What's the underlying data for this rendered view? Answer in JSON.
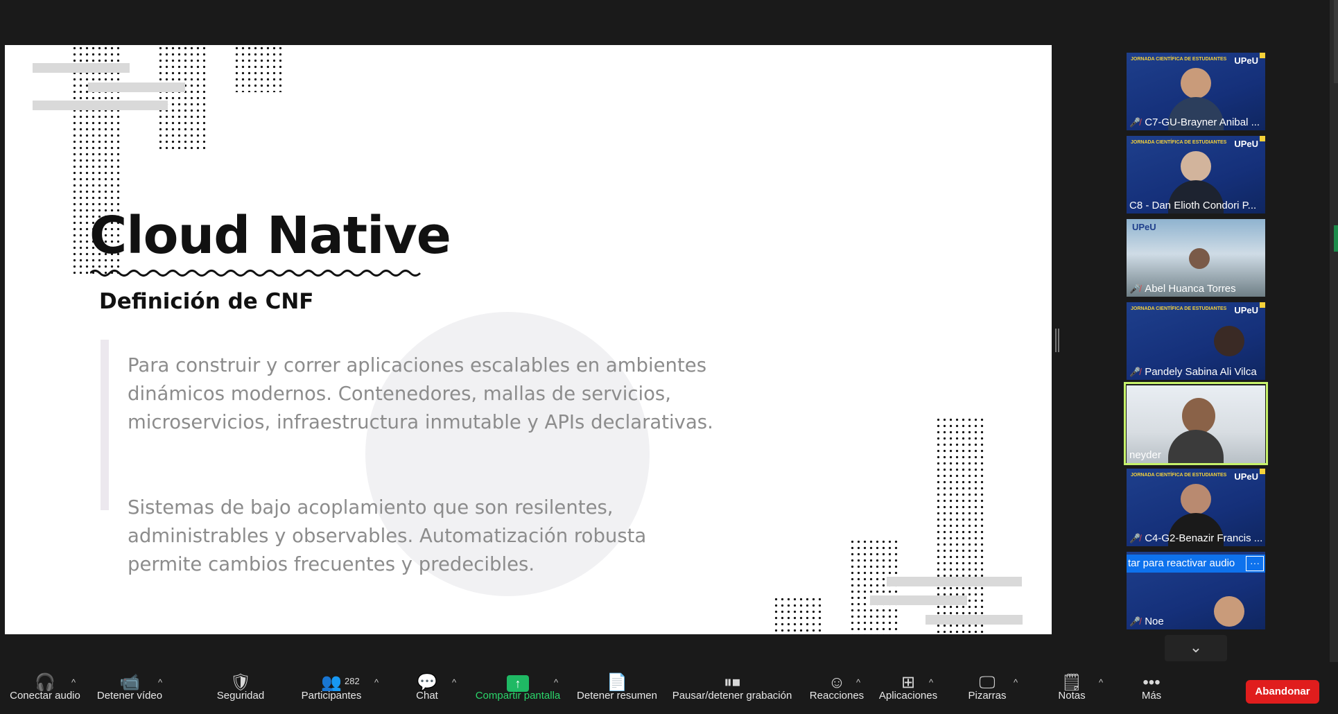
{
  "slide": {
    "title": "Cloud Native",
    "subtitle": "Definición de CNF",
    "paragraph1": "Para construir y correr aplicaciones escalables en ambientes dinámicos modernos. Contenedores, mallas de servicios, microservicios, infraestructura inmutable y APIs declarativas.",
    "paragraph2": "Sistemas de bajo acoplamiento que son resilentes, administrables y observables. Automatización robusta permite cambios frecuentes y predecibles."
  },
  "participants": [
    {
      "name": "C7-GU-Brayner Anibal ...",
      "muted": true
    },
    {
      "name": "C8 - Dan Elioth Condori P...",
      "muted": false
    },
    {
      "name": "Abel Huanca Torres",
      "muted": true
    },
    {
      "name": "Pandely Sabina Ali Vilca",
      "muted": true
    },
    {
      "name": "neyder",
      "muted": false,
      "active": true
    },
    {
      "name": "C4-G2-Benazir Francis ...",
      "muted": true
    },
    {
      "name": "Noe",
      "muted": true
    }
  ],
  "tile_badge": {
    "banner": "JORNADA CIENTÍFICA DE ESTUDIANTES",
    "logo": "UPeU"
  },
  "unmute_banner": "tar para reactivar audio",
  "toolbar": {
    "audio": "Conectar audio",
    "video": "Detener vídeo",
    "security": "Seguridad",
    "participants": "Participantes",
    "participants_count": "282",
    "chat": "Chat",
    "share": "Compartir pantalla",
    "summary": "Detener resumen",
    "record": "Pausar/detener grabación",
    "reactions": "Reacciones",
    "apps": "Aplicaciones",
    "whiteboards": "Pizarras",
    "notes": "Notas",
    "more": "Más",
    "leave": "Abandonar"
  },
  "colors": {
    "accent_green": "#1fb964",
    "leave_red": "#e01d1d",
    "active_border": "#c7f26b",
    "banner_blue": "#0e72ed"
  }
}
